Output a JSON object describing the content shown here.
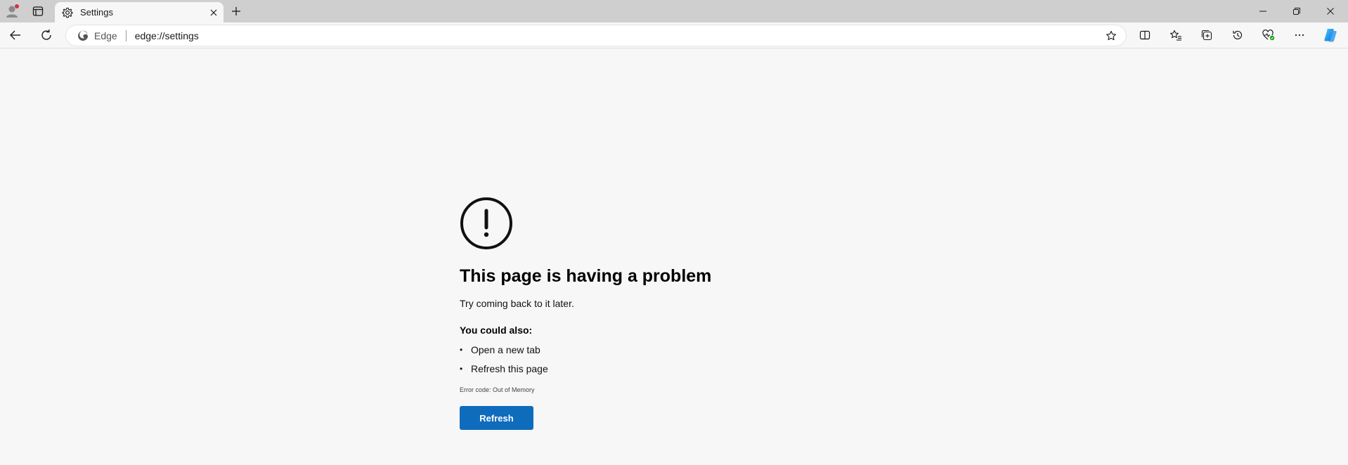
{
  "tab": {
    "title": "Settings",
    "icon": "gear-icon"
  },
  "omnibox": {
    "brand": "Edge",
    "url": "edge://settings"
  },
  "error": {
    "title": "This page is having a problem",
    "subtitle": "Try coming back to it later.",
    "also_title": "You could also:",
    "suggestions": [
      "Open a new tab",
      "Refresh this page"
    ],
    "error_code": "Error code: Out of Memory",
    "button_label": "Refresh"
  },
  "colors": {
    "accent": "#0f6cbd",
    "tabstrip": "#cfcfcf",
    "page_bg": "#f7f7f7",
    "profile_dot": "#d13438"
  }
}
